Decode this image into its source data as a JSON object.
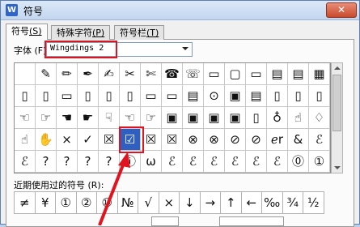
{
  "window": {
    "app_icon_glyph": "W",
    "title": "符号",
    "close_glyph": "✕"
  },
  "tabs": [
    {
      "label": "符号",
      "hotkey": "(S)"
    },
    {
      "label": "特殊字符",
      "hotkey": "(P)"
    },
    {
      "label": "符号栏",
      "hotkey": "(T)"
    }
  ],
  "font": {
    "label": "字体 (F):",
    "value": "Wingdings 2"
  },
  "symbol_grid": [
    [
      "",
      "✎",
      "✏",
      "✒",
      "✍",
      "✂",
      "✄",
      "☎",
      "☏",
      "▭",
      "▢",
      "▭",
      "▤",
      "▤",
      "▦"
    ],
    [
      "▯",
      "▯",
      "▭",
      "▯",
      "▯",
      "▯",
      "▭",
      "▭",
      "▤",
      "⊙",
      "▣",
      "▤",
      "▯",
      "▯",
      "▯"
    ],
    [
      "☜",
      "☞",
      "☚",
      "☛",
      "☟",
      "☜",
      "☞",
      "▣",
      "▣",
      "▣",
      "▣",
      "▯",
      "♁",
      "☝",
      "♢"
    ],
    [
      "☝",
      "✋",
      "×",
      "✓",
      "☒",
      "☑",
      "☒",
      "☒",
      "⊗",
      "⊗",
      "⊘",
      "⊘",
      "ℯr",
      "&",
      "ℰ"
    ],
    [
      "ℰ",
      "?",
      "?",
      "?",
      "?",
      "ⓘ",
      "ω",
      "ℰ",
      "ℰ",
      "ℰ",
      "ℰ",
      "ℰ",
      "ℰ",
      "⓪",
      "①"
    ]
  ],
  "selected_symbol": "☑",
  "recent": {
    "label": "近期使用过的符号 (R):",
    "symbols": [
      "≠",
      "¥",
      "①",
      "②",
      "⑩",
      "№",
      "√",
      "×",
      "↓",
      "→",
      "↑",
      "←",
      "‰",
      "¾",
      "½"
    ]
  },
  "colors": {
    "highlight": "#e0141e",
    "selection": "#2f5fc0"
  }
}
